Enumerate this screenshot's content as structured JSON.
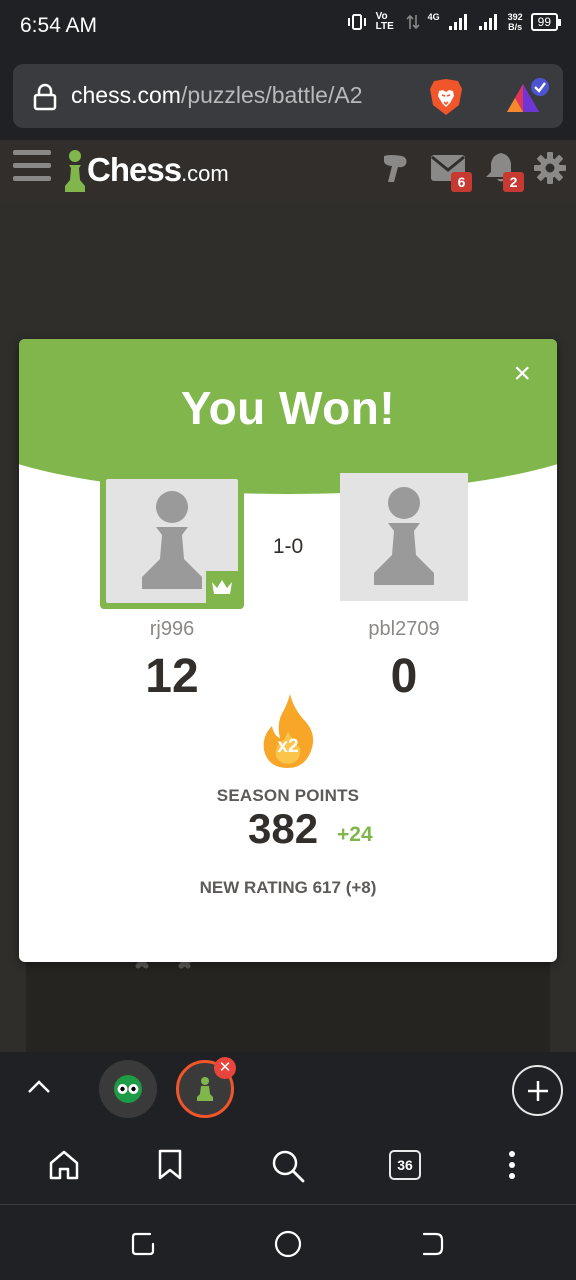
{
  "status_bar": {
    "time": "6:54 AM",
    "network": "Vo LTE",
    "network_type": "4G",
    "speed_value": "392",
    "speed_unit": "B/s",
    "battery": "99"
  },
  "browser": {
    "url_domain": "chess.com",
    "url_path": "/puzzles/battle/A2",
    "icons": [
      "lock-icon",
      "brave-lion-icon",
      "brave-rewards-icon"
    ]
  },
  "chess_header": {
    "logo_text": "Chess",
    "logo_suffix": ".com",
    "messages_count": "6",
    "notifications_count": "2"
  },
  "result_modal": {
    "title": "You Won!",
    "close_label": "×",
    "score": "1-0",
    "player": {
      "username": "rj996",
      "points": "12",
      "winner": true
    },
    "opponent": {
      "username": "pbl2709",
      "points": "0",
      "winner": false
    },
    "multiplier": "x2",
    "season_label": "SEASON POINTS",
    "season_points": "382",
    "season_delta": "+24",
    "new_rating": "NEW RATING 617 (+8)"
  },
  "tab_strip": {
    "tab_count": "36"
  },
  "colors": {
    "chess_green": "#81b64c",
    "chess_dark": "#312e2b",
    "badge_red": "#c73a32",
    "browser_dark": "#202124"
  }
}
